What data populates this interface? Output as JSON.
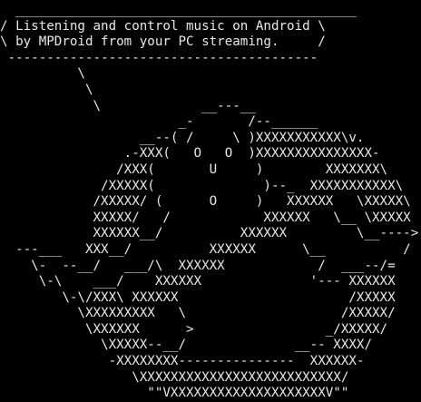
{
  "terminal": {
    "background": "#000000",
    "foreground": "#e8e8e8",
    "lines": [
      "  ____________________________________________",
      "/ Listening and control music on Android \\",
      "\\ by MPDroid from your PC streaming.     /",
      " ----------------------------------------",
      "          \\",
      "           \\",
      "            \\             __---__",
      "                       _-       /--______",
      "                  __--( /     \\ )XXXXXXXXXXX\\v.",
      "                .-XXX(   O   O  )XXXXXXXXXXXXXXX-",
      "               /XXX(       U     )        XXXXXXX\\",
      "             /XXXXX(              )--_  XXXXXXXXXXX\\",
      "            /XXXXX/ (      O     )   XXXXXX   \\XXXXX\\",
      "            XXXXX/   /            XXXXXX   \\__ \\XXXXX",
      "            XXXXXX__/          XXXXXX         \\__---->",
      "  ---___   XXX__/          XXXXXX      \\__          /",
      "    \\-  --__/   ___/\\  XXXXXX            /  ___--/=",
      "     \\-\\    ___/    XXXXXX              '--- XXXXXX",
      "        \\-\\/XXX\\ XXXXXX                      /XXXXX",
      "          \\XXXXXXXXX   \\                    /XXXXX/",
      "           \\XXXXXX      >                 _/XXXXX/",
      "             \\XXXXX--__/              __-- XXXX/",
      "              -XXXXXXXX---------------  XXXXXX-",
      "                 \\XXXXXXXXXXXXXXXXXXXXXXXXXX/",
      "                   \"\"VXXXXXXXXXXXXXXXXXXXXV\"\""
    ]
  }
}
